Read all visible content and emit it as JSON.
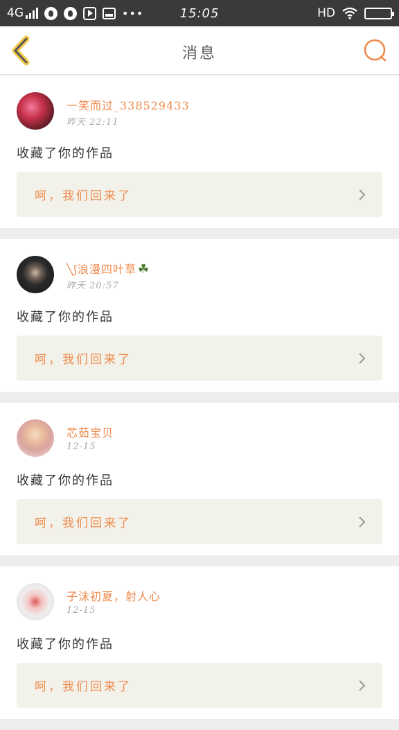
{
  "status_bar": {
    "network": "4G",
    "time": "15:05",
    "hd_label": "HD",
    "overflow": "•••"
  },
  "header": {
    "title": "消息",
    "accent_color": "#ef8a4c"
  },
  "notifications": [
    {
      "username": "一笑而过_338529433",
      "time": "昨天 22:11",
      "message": "收藏了你的作品",
      "reply": "呵，我们回来了"
    },
    {
      "username": "╲ʃ浪漫四叶草",
      "username_icon": "four-leaf-clover-icon",
      "time": "昨天 20:57",
      "message": "收藏了你的作品",
      "reply": "呵，我们回来了"
    },
    {
      "username": "芯茹宝贝",
      "time": "12-15",
      "message": "收藏了你的作品",
      "reply": "呵，我们回来了"
    },
    {
      "username": "子沫初夏，射人心",
      "time": "12-15",
      "message": "收藏了你的作品",
      "reply": "呵，我们回来了"
    }
  ]
}
